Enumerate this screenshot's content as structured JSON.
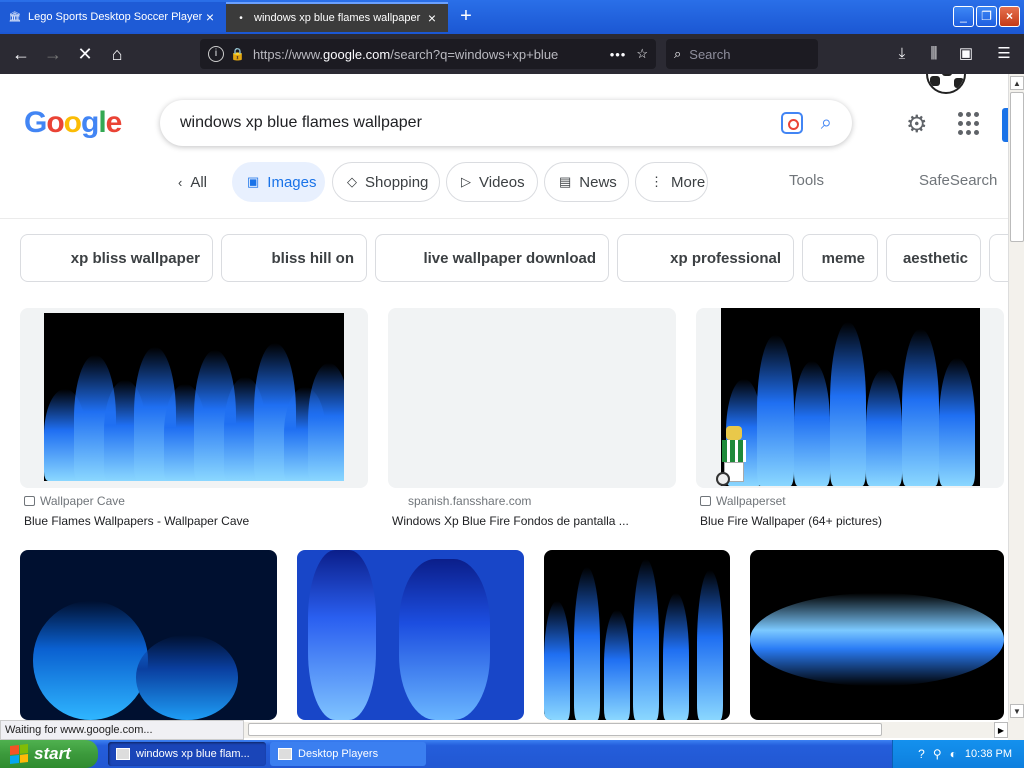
{
  "browser": {
    "tabs": [
      {
        "title": "Lego Sports Desktop Soccer Players",
        "active": false
      },
      {
        "title": "windows xp blue flames wallpaper",
        "active": true
      }
    ],
    "url_prefix": "https://www.",
    "url_domain": "google.com",
    "url_path": "/search?q=windows+xp+blue",
    "search_placeholder": "Search",
    "status_text": "Waiting for www.google.com..."
  },
  "google": {
    "logo": "Google",
    "query": "windows xp blue flames wallpaper",
    "nav_chips": [
      "All",
      "Images",
      "Shopping",
      "Videos",
      "News",
      "More"
    ],
    "selected_chip": "Images",
    "tools": "Tools",
    "safesearch": "SafeSearch",
    "related": [
      "xp bliss wallpaper",
      "bliss hill on",
      "live wallpaper download",
      "xp professional",
      "meme",
      "aesthetic"
    ],
    "results": [
      {
        "source": "Wallpaper Cave",
        "title": "Blue Flames Wallpapers - Wallpaper Cave"
      },
      {
        "source": "spanish.fansshare.com",
        "title": "Windows Xp Blue Fire Fondos de pantalla ..."
      },
      {
        "source": "Wallpaperset",
        "title": "Blue Fire Wallpaper (64+ pictures)"
      }
    ]
  },
  "taskbar": {
    "start": "start",
    "windows": [
      "windows xp blue flam...",
      "Desktop Players"
    ],
    "clock": "10:38 PM"
  },
  "colors": {
    "google_blue": "#4285f4",
    "google_red": "#ea4335",
    "google_yellow": "#fbbc05",
    "google_green": "#34a853",
    "selected_chip_bg": "#e8f0fe",
    "taskbar_blue": "#245edb",
    "start_green": "#3c9a3c"
  }
}
